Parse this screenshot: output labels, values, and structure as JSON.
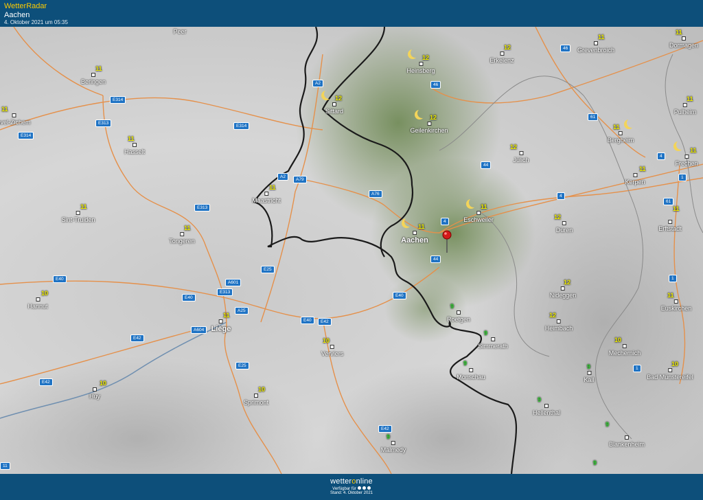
{
  "header": {
    "app_title": "WetterRadar",
    "location": "Aachen",
    "timestamp": "4. Oktober 2021 um 05:35"
  },
  "footer": {
    "brand_pre": "wetter",
    "brand_mid": "o",
    "brand_post": "nline",
    "available": "Verfügbar für",
    "stand": "Stand: 4. Oktober 2021"
  },
  "colors": {
    "bar": "#0d4f7a",
    "accent": "#ffcc00",
    "road": "#e5904a",
    "border": "#1a1a1a",
    "river": "#6f8fb0"
  },
  "cities": {
    "peer": "Peer",
    "beringen": "Beringen",
    "zichem": "uvel-Zichem",
    "hasselt": "Hasselt",
    "sint_truiden": "Sint-Truiden",
    "tongeren": "Tongeren",
    "maastricht": "Maastricht",
    "hannut": "Hannut",
    "liege": "Liège",
    "huy": "Huy",
    "sprimont": "Sprimont",
    "verviers": "Verviers",
    "malmedy": "Malmedy",
    "sittard": "Sittard",
    "heinsberg": "Heinsberg",
    "geilenkirchen": "Geilenkirchen",
    "erkelenz": "Erkelenz",
    "grevenbroich": "Grevenbroich",
    "dormagen": "Dormagen",
    "pulheim": "Pulheim",
    "bergheim": "Bergheim",
    "frechen": "Frechen",
    "kerpen": "Kerpen",
    "juelich": "Jülich",
    "eschweiler": "Eschweiler",
    "aachen": "Aachen",
    "dueren": "Düren",
    "erftstadt": "Erftstadt",
    "nideggen": "Nideggen",
    "roetgen": "Roetgen",
    "simmerath": "Simmerath",
    "heimbach": "Heimbach",
    "monschau": "Monschau",
    "euskirchen": "Euskirchen",
    "mechernich": "Mechernich",
    "kall": "Kall",
    "bad_muenstereifel": "Bad Münstereifel",
    "hellenthal": "Hellenthal",
    "blankenheim": "Blankenheim"
  },
  "temps": {
    "beringen": "11",
    "zichem": "11",
    "hasselt": "11",
    "sint_truiden": "11",
    "tongeren": "11",
    "maastricht": "11",
    "hannut": "10",
    "liege": "11",
    "huy": "10",
    "sprimont": "10",
    "verviers": "10",
    "malmedy": "9",
    "sittard": "12",
    "heinsberg": "12",
    "geilenkirchen": "12",
    "erkelenz": "12",
    "grevenbroich": "11",
    "dormagen": "11",
    "pulheim": "11",
    "bergheim": "11",
    "frechen": "11",
    "kerpen": "11",
    "juelich": "12",
    "eschweiler": "11",
    "aachen": "11",
    "dueren": "12",
    "erftstadt": "11",
    "nideggen": "12",
    "roetgen": "9",
    "simmerath": "9",
    "heimbach": "12",
    "monschau": "9",
    "euskirchen": "11",
    "mechernich": "10",
    "kall": "9",
    "bad_muenstereifel": "10",
    "hellenthal": "9",
    "blankenheim": "9",
    "bottom": "9"
  },
  "roads": {
    "e314a": "E314",
    "e314b": "E314",
    "e314c": "E314",
    "e313a": "E313",
    "e313b": "E313",
    "e313c": "E313",
    "a2a": "A2",
    "a2b": "A2",
    "a79": "A79",
    "a76": "A76",
    "e40a": "E40",
    "e40b": "E40",
    "e40c": "E40",
    "e40d": "E40",
    "e42a": "E42",
    "e42b": "E42",
    "e42c": "E42",
    "e42d": "E42",
    "a601": "A601",
    "a604": "A604",
    "e25a": "E25",
    "e25b": "E25",
    "a25": "A25",
    "r46a": "46",
    "r46b": "46",
    "r61a": "61",
    "r61b": "61",
    "r4a": "4",
    "r4b": "4",
    "r4c": "4",
    "r44a": "44",
    "r44b": "44",
    "r1a": "1",
    "r1b": "1",
    "r1c": "1",
    "r11": "11"
  },
  "icons": {
    "location_pin": "map-pin-icon",
    "night": "moon-icon"
  }
}
